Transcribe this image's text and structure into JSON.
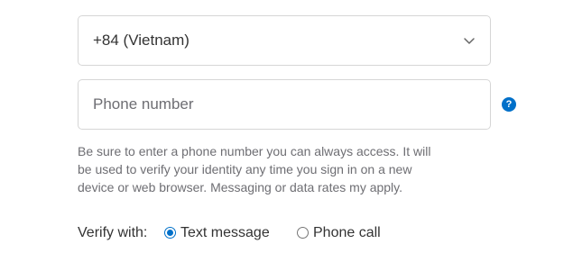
{
  "country_select": {
    "value": "+84 (Vietnam)",
    "chevron_icon": "chevron-down-icon"
  },
  "phone": {
    "value": "",
    "placeholder": "Phone number",
    "help_icon": "question-mark",
    "help_icon_glyph": "?"
  },
  "notice": {
    "lines": [
      "Be sure to enter a phone number you can always access. It will",
      "be used to verify your identity any time you sign in on a new",
      "device or web browser. Messaging or data rates my apply."
    ]
  },
  "verify": {
    "label": "Verify with:",
    "options": [
      {
        "label": "Text message",
        "checked": true
      },
      {
        "label": "Phone call",
        "checked": false
      }
    ]
  },
  "colors": {
    "accent": "#0070c9",
    "border": "#d6d6d6",
    "muted_text": "#6e6e73",
    "text": "#333333"
  }
}
